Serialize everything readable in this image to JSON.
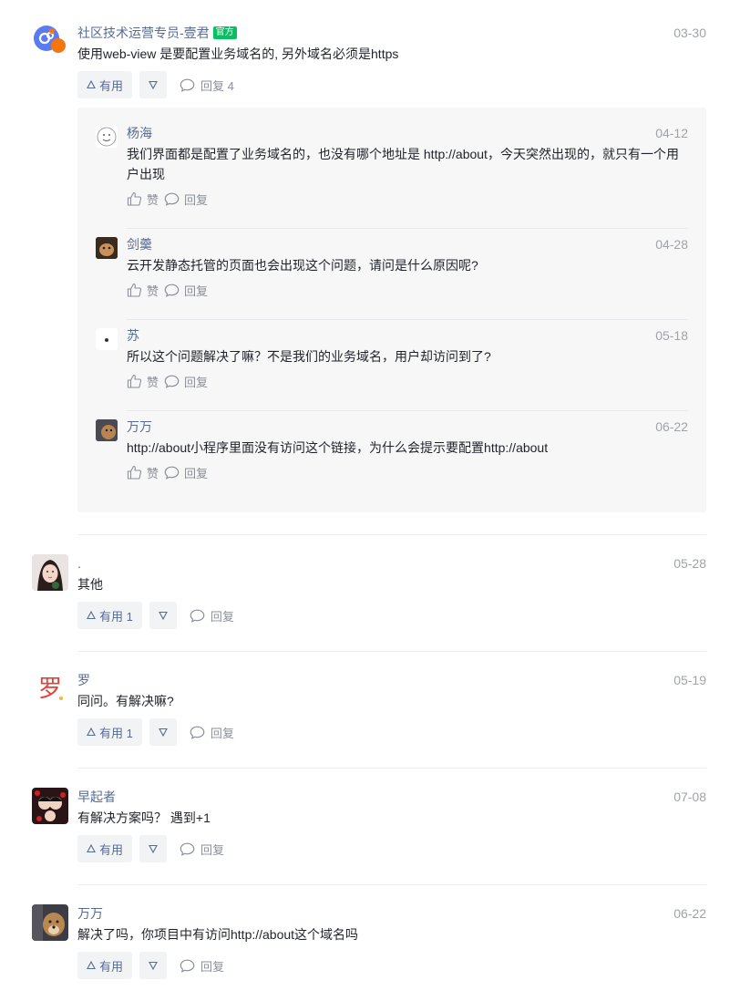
{
  "colors": {
    "link": "#576b95",
    "muted": "#a0a3a8",
    "official_badge": "#07c160"
  },
  "top_comment": {
    "author": "社区技术运营专员-壹君",
    "badge": "官方",
    "date": "03-30",
    "text": "使用web-view 是要配置业务域名的, 另外域名必须是https",
    "useful_label": "有用",
    "reply_label": "回复 4",
    "replies": [
      {
        "author": "杨海",
        "date": "04-12",
        "text": "我们界面都是配置了业务域名的，也没有哪个地址是 http://about，今天突然出现的，就只有一个用户出现",
        "like": "赞",
        "reply": "回复"
      },
      {
        "author": "剑羹",
        "date": "04-28",
        "text": "云开发静态托管的页面也会出现这个问题，请问是什么原因呢?",
        "like": "赞",
        "reply": "回复"
      },
      {
        "author": "苏",
        "date": "05-18",
        "text": "所以这个问题解决了嘛？不是我们的业务域名，用户却访问到了?",
        "like": "赞",
        "reply": "回复"
      },
      {
        "author": "万万",
        "date": "06-22",
        "text": "http://about小程序里面没有访问这个链接，为什么会提示要配置http://about",
        "like": "赞",
        "reply": "回复"
      }
    ]
  },
  "comments": [
    {
      "author": ".",
      "date": "05-28",
      "text": "其他",
      "useful_label": "有用 1",
      "reply_label": "回复"
    },
    {
      "author": "罗",
      "date": "05-19",
      "text": "同问。有解决嘛?",
      "useful_label": "有用 1",
      "reply_label": "回复"
    },
    {
      "author": "早起者",
      "date": "07-08",
      "text": "有解决方案吗？ 遇到+1",
      "useful_label": "有用",
      "reply_label": "回复"
    },
    {
      "author": "万万",
      "date": "06-22",
      "text": "解决了吗，你项目中有访问http://about这个域名吗",
      "useful_label": "有用",
      "reply_label": "回复"
    }
  ]
}
